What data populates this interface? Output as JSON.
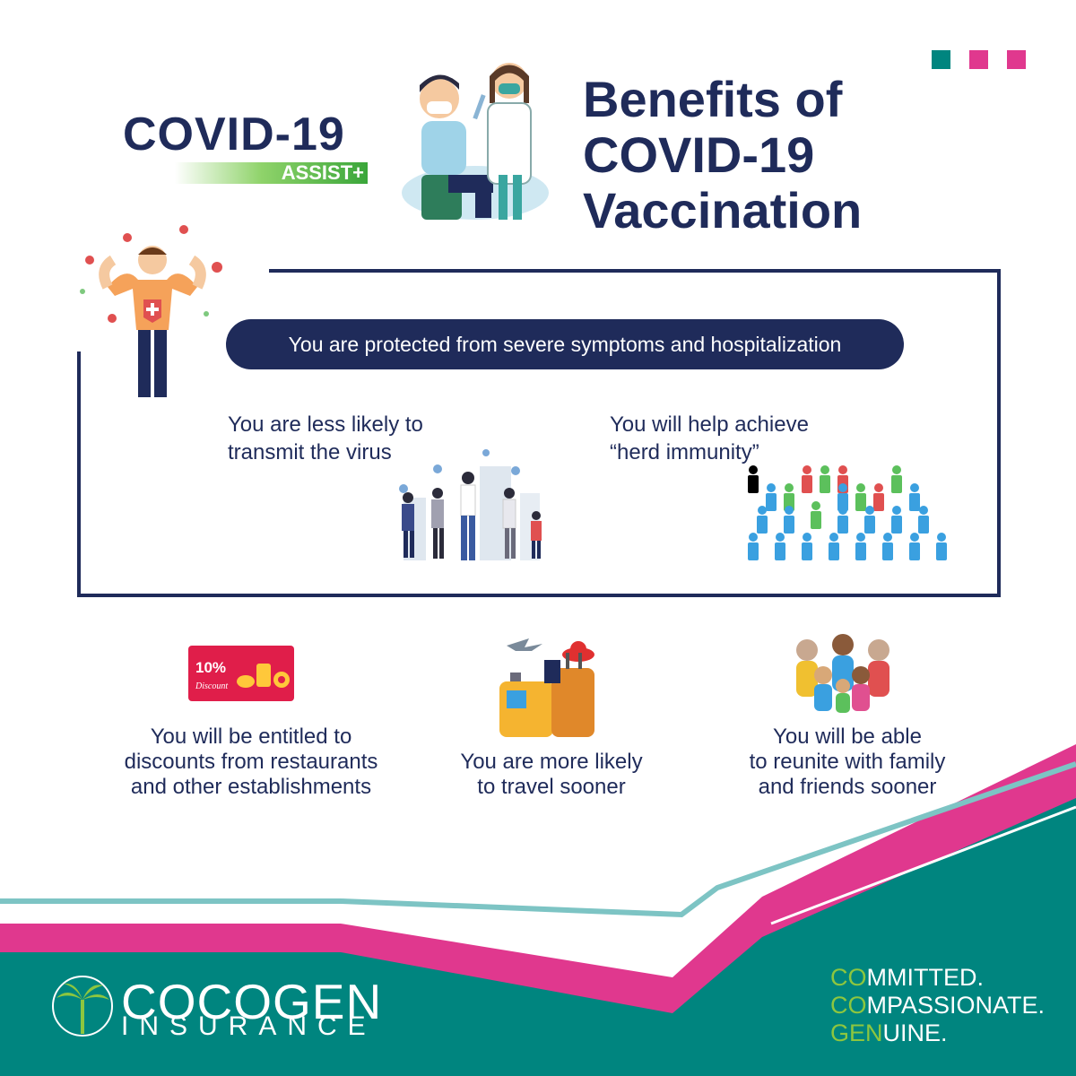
{
  "colors": {
    "navy": "#1f2b5a",
    "teal": "#00857f",
    "magenta": "#e0388e",
    "green": "#8dc63f",
    "light_teal": "#7dc4c4"
  },
  "header": {
    "logo": {
      "main": "COVID-19",
      "sub": "ASSIST+"
    },
    "title_lines": [
      "Benefits of",
      "COVID-19",
      "Vaccination"
    ]
  },
  "benefits_box": {
    "highlight": "You are protected from severe symptoms and hospitalization",
    "left_text": [
      "You are less likely to",
      "transmit the virus"
    ],
    "right_text": [
      "You will help achieve",
      "“herd immunity”"
    ],
    "discount_label": "10%",
    "discount_script": "Discount"
  },
  "benefits": [
    {
      "lines": [
        "You will be entitled to",
        "discounts from restaurants",
        "and other establishments"
      ],
      "icon": "discount-card-icon"
    },
    {
      "lines": [
        "You are more likely",
        "to travel sooner"
      ],
      "icon": "luggage-icon"
    },
    {
      "lines": [
        "You will be able",
        "to reunite with family",
        "and friends sooner"
      ],
      "icon": "family-icon"
    }
  ],
  "footer": {
    "brand_main": "COCOGEN",
    "brand_sub": "INSURANCE",
    "tagline": [
      {
        "accent": "CO",
        "rest": "MMITTED."
      },
      {
        "accent": "CO",
        "rest": "MPASSIONATE."
      },
      {
        "accent": "GEN",
        "rest": "UINE."
      }
    ]
  }
}
